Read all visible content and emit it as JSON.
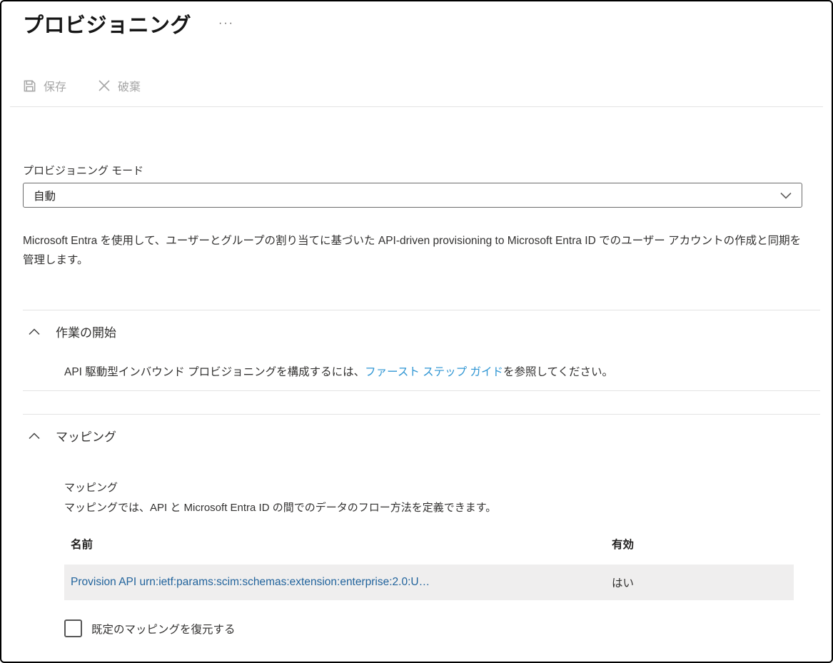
{
  "page": {
    "title": "プロビジョニング",
    "more_menu": "···"
  },
  "toolbar": {
    "save_label": "保存",
    "discard_label": "破棄"
  },
  "provisioning_mode": {
    "label": "プロビジョニング モード",
    "value": "自動"
  },
  "intro_description": "Microsoft Entra を使用して、ユーザーとグループの割り当てに基づいた API-driven provisioning to Microsoft Entra ID でのユーザー アカウントの作成と同期を管理します。",
  "getting_started": {
    "title": "作業の開始",
    "text_before_link": "API 駆動型インバウンド プロビジョニングを構成するには、",
    "link_text": "ファースト ステップ ガイド",
    "text_after_link": "を参照してください。"
  },
  "mappings": {
    "title": "マッピング",
    "sub_label": "マッピング",
    "description": "マッピングでは、API と Microsoft Entra ID の間でのデータのフロー方法を定義できます。",
    "table": {
      "columns": [
        "名前",
        "有効"
      ],
      "rows": [
        {
          "name": "Provision API urn:ietf:params:scim:schemas:extension:enterprise:2.0:U…",
          "enabled": "はい"
        }
      ]
    },
    "restore_checkbox_label": "既定のマッピングを復元する"
  },
  "colors": {
    "link_blue": "#2e95d3",
    "row_name_blue": "#21639c",
    "row_background": "#efeeee",
    "disabled_gray": "#a6a6a6",
    "divider_gray": "#e3e3e3"
  }
}
